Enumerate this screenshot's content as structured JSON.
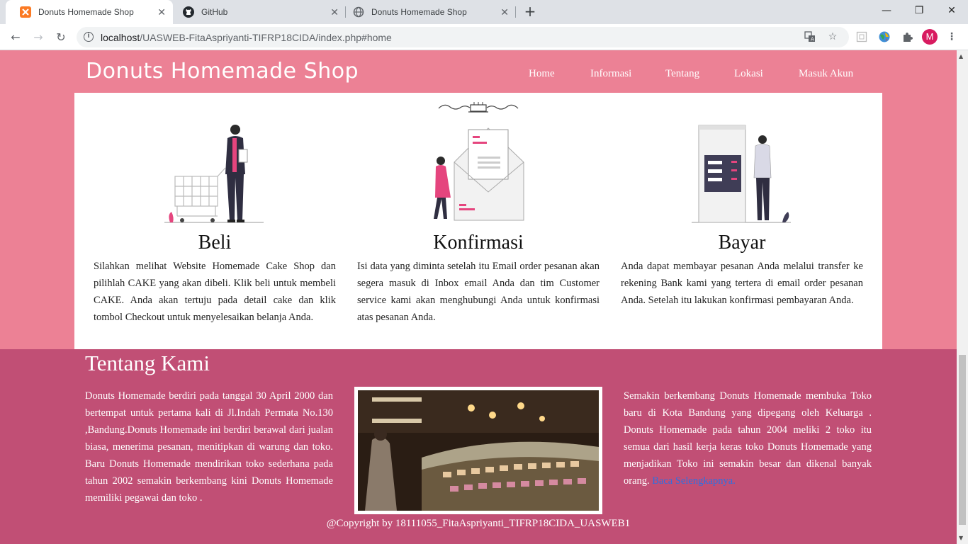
{
  "browser": {
    "tabs": [
      {
        "title": "Donuts Homemade Shop",
        "active": true,
        "icon": "xampp-icon"
      },
      {
        "title": "GitHub",
        "active": false,
        "icon": "github-icon"
      },
      {
        "title": "Donuts Homemade Shop",
        "active": false,
        "icon": "globe-icon"
      }
    ],
    "url_host": "localhost",
    "url_path": "/UASWEB-FitaAspriyanti-TIFRP18CIDA/index.php#home",
    "profile_initial": "M"
  },
  "site": {
    "brand": "Donuts Homemade Shop",
    "nav": [
      "Home",
      "Informasi",
      "Tentang",
      "Lokasi",
      "Masuk Akun"
    ],
    "steps": [
      {
        "title": "Beli",
        "text": "Silahkan melihat Website Homemade Cake Shop dan pilihlah CAKE yang akan dibeli. Klik beli untuk membeli CAKE. Anda akan tertuju pada detail cake dan klik tombol Checkout untuk menyelesaikan belanja Anda."
      },
      {
        "title": "Konfirmasi",
        "text": "Isi data yang diminta setelah itu Email order pesanan akan segera masuk di Inbox email Anda dan tim Customer service kami akan menghubungi Anda untuk konfirmasi atas pesanan Anda."
      },
      {
        "title": "Bayar",
        "text": "Anda dapat membayar pesanan Anda melalui transfer ke rekening Bank kami yang tertera di email order pesanan Anda. Setelah itu lakukan konfirmasi pembayaran Anda."
      }
    ],
    "about": {
      "title": "Tentang Kami",
      "left": "Donuts Homemade berdiri pada tanggal 30 April 2000 dan bertempat untuk pertama kali di Jl.Indah Permata No.130 ,Bandung.Donuts Homemade ini berdiri berawal dari jualan biasa, menerima pesanan, menitipkan di warung dan toko. Baru Donuts Homemade mendirikan toko sederhana pada tahun 2002 semakin berkembang kini Donuts Homemade memiliki pegawai dan toko .",
      "right": "Semakin berkembang Donuts Homemade membuka Toko baru di Kota Bandung yang dipegang oleh Keluarga . Donuts Homemade pada tahun 2004 meliki 2 toko itu semua dari hasil kerja keras toko Donuts Homemade yang menjadikan Toko ini semakin besar dan dikenal banyak orang.",
      "more_link": "Baca Selengkapnya."
    },
    "copyright": "@Copyright by 18111055_FitaAspriyanti_TIFRP18CIDA_UASWEB1"
  },
  "colors": {
    "header_pink": "#ec8195",
    "about_bg": "#c14f75",
    "accent_pink": "#e5457e",
    "link_blue": "#2f6fe0"
  }
}
